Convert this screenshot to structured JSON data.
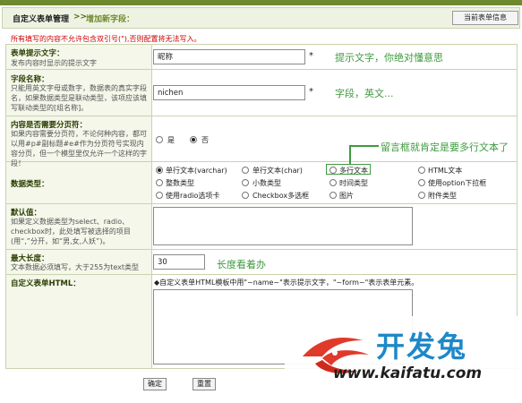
{
  "header": {
    "title": "自定义表单管理",
    "arrow": ">>",
    "subtitle": "增加新字段：",
    "current_info_button": "当前表单信息"
  },
  "notice": "所有填写的内容不允许包含双引号(\"),否则配置将无法写入。",
  "fields": {
    "prompt": {
      "label": "表单提示文字：",
      "desc": "发布内容时显示的提示文字",
      "value": "昵称",
      "required_mark": "*",
      "annotation": "提示文字，你绝对懂意思"
    },
    "field_name": {
      "label": "字段名称：",
      "desc": "只能用英文字母或数字，数据表的真实字段名，如果数据类型是联动类型，该项应该填写联动类型的[组名称]。",
      "value": "nichen",
      "required_mark": "*",
      "annotation": "字段，英文..."
    },
    "paging": {
      "label": "内容是否需要分页符：",
      "desc": "如果内容需要分页符，不论何种内容，都可以用#p#副标题#e#作为分页符号实现内容分页，但一个模型里仅允许一个这样的字段！",
      "options": [
        "是",
        "否"
      ],
      "selected": "否"
    },
    "datatype": {
      "label": "数据类型：",
      "annotation": "留言框就肯定是要多行文本了",
      "options": [
        "单行文本(varchar)",
        "单行文本(char)",
        "多行文本",
        "HTML文本",
        "整数类型",
        "小数类型",
        "时间类型",
        "使用option下拉框",
        "使用radio选项卡",
        "Checkbox多选框",
        "图片",
        "附件类型"
      ],
      "selected": "单行文本(varchar)"
    },
    "default": {
      "label": "默认值：",
      "desc": "如果定义数据类型为select、radio、checkbox时，此处填写被选择的项目(用“,”分开，如“男,女,人妖”)。"
    },
    "maxlen": {
      "label": "最大长度：",
      "desc": "文本数据必须填写，大于255为text类型",
      "value": "30",
      "annotation": "长度看着办"
    },
    "html": {
      "label": "自定义表单HTML：",
      "hint": "◆自定义表单HTML模板中用\"~name~\"表示提示文字，\"~form~\"表示表单元素。"
    }
  },
  "buttons": {
    "confirm": "确定",
    "reset": "重置"
  },
  "watermark": {
    "brand": "开发兔",
    "url": "www.kaifatu.com"
  },
  "colors": {
    "accent": "#6f8a2e",
    "annotation": "#3f9a3f",
    "notice": "#cc0000",
    "label_bg": "#f4f7ea"
  }
}
